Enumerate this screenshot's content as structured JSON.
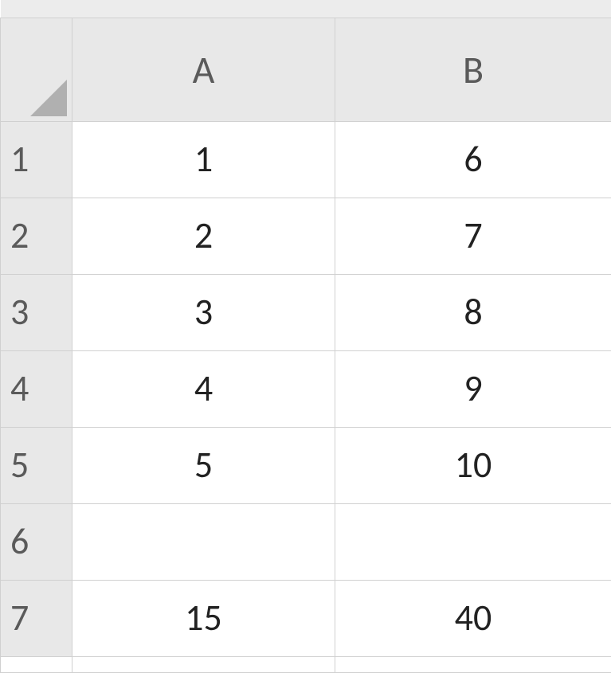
{
  "columns": [
    "A",
    "B"
  ],
  "rows": [
    {
      "header": "1",
      "cells": [
        "1",
        "6"
      ],
      "bold": false
    },
    {
      "header": "2",
      "cells": [
        "2",
        "7"
      ],
      "bold": false
    },
    {
      "header": "3",
      "cells": [
        "3",
        "8"
      ],
      "bold": false
    },
    {
      "header": "4",
      "cells": [
        "4",
        "9"
      ],
      "bold": false
    },
    {
      "header": "5",
      "cells": [
        "5",
        "10"
      ],
      "bold": false
    },
    {
      "header": "6",
      "cells": [
        "",
        ""
      ],
      "bold": false
    },
    {
      "header": "7",
      "cells": [
        "15",
        "40"
      ],
      "bold": true
    }
  ]
}
